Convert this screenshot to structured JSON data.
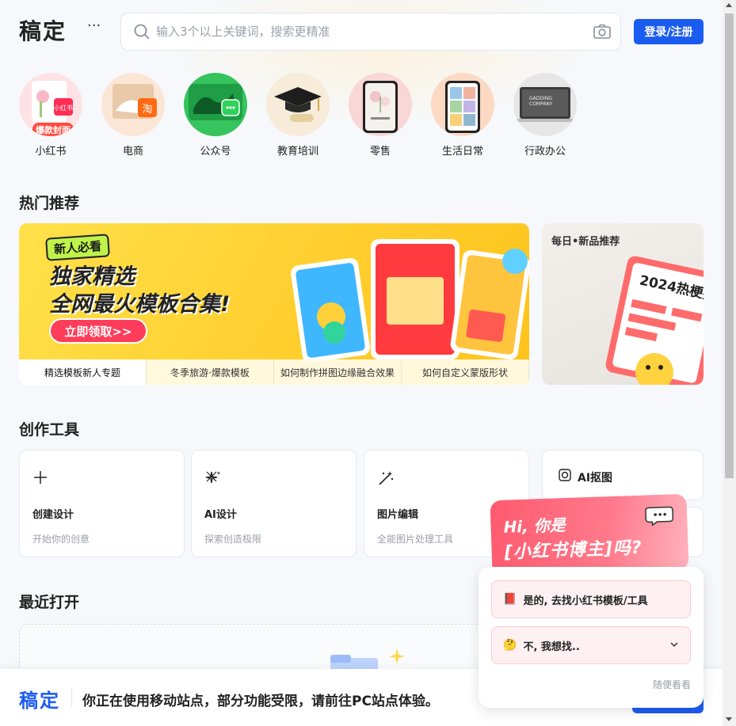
{
  "header": {
    "logo": "稿定",
    "more_label": "···",
    "search_placeholder": "输入3个以上关键词，搜索更精准",
    "login_label": "登录/注册"
  },
  "categories": [
    {
      "label": "小红书",
      "badge": "爆款封面",
      "icon": "xiaohongshu-thumb"
    },
    {
      "label": "电商",
      "icon": "ecommerce-thumb"
    },
    {
      "label": "公众号",
      "icon": "wechat-thumb"
    },
    {
      "label": "教育培训",
      "icon": "education-thumb"
    },
    {
      "label": "零售",
      "icon": "retail-thumb"
    },
    {
      "label": "生活日常",
      "icon": "daily-life-thumb"
    },
    {
      "label": "行政办公",
      "icon": "office-thumb"
    }
  ],
  "hot": {
    "title": "热门推荐",
    "banner": {
      "tag": "新人必看",
      "headline1": "独家精选",
      "headline2": "全网最火模板合集!",
      "cta": "立即领取>>",
      "tabs": [
        "精选模板新人专题",
        "冬季旅游·爆款模板",
        "如何制作拼图边缘融合效果",
        "如何自定义蒙版形状"
      ]
    },
    "side_card": {
      "title": "每日•新品推荐",
      "poster": "2024热梗指南"
    }
  },
  "tools": {
    "title": "创作工具",
    "cards": [
      {
        "name": "创建设计",
        "desc": "开始你的创意",
        "icon": "plus-icon"
      },
      {
        "name": "AI设计",
        "desc": "探索创造极限",
        "icon": "sparkle-icon"
      },
      {
        "name": "图片编辑",
        "desc": "全能图片处理工具",
        "icon": "magic-wand-icon"
      }
    ],
    "mini": [
      {
        "name": "AI抠图",
        "icon": "cutout-icon"
      }
    ]
  },
  "recent": {
    "title": "最近打开"
  },
  "notice": {
    "logo": "稿定",
    "text": "你正在使用移动站点，部分功能受限，请前往PC站点体验。"
  },
  "popup": {
    "greeting1": "Hi, 你是",
    "greeting2": "[小红书博主]吗?",
    "option_yes": "是的, 去找小红书模板/工具",
    "option_no": "不, 我想找..",
    "skip": "随便看看"
  },
  "colors": {
    "accent": "#1b5cf0",
    "popup": "#ff5a6e",
    "banner": "#ffd233"
  }
}
